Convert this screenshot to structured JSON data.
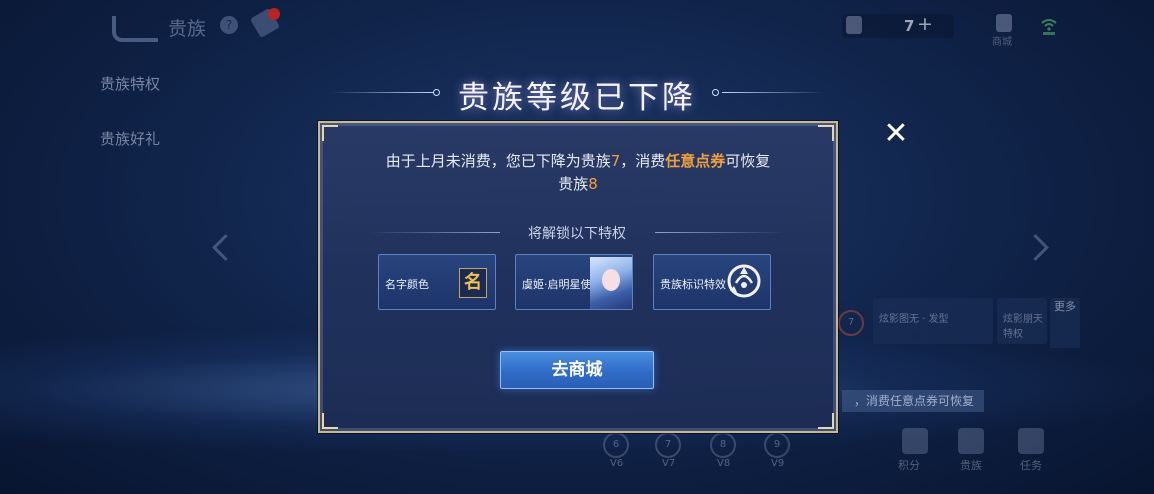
{
  "background": {
    "header": {
      "title": "贵族",
      "help_icon": "question-icon",
      "gift_badge": "新"
    },
    "side_tabs": [
      "贵族特权",
      "贵族好礼"
    ],
    "currency": {
      "value": "7",
      "plus": "+"
    },
    "shop_label": "商城",
    "cards": [
      {
        "label": "炫影图无 · 发型"
      },
      {
        "label": "炫影朋天 特权"
      }
    ],
    "more_label": "更多",
    "hint": "，消费任意点券可恢复",
    "tiers": [
      "V6",
      "V7",
      "V8",
      "V9"
    ],
    "tier_numbers": [
      "6",
      "7",
      "8",
      "9"
    ],
    "bottom_actions": [
      "积分",
      "贵族",
      "任务"
    ]
  },
  "modal": {
    "title": "贵族等级已下降",
    "message_part1": "由于上月未消费，您已下降为贵族",
    "current_level": "7",
    "message_part2": "，消费",
    "ticket_text": "任意点券",
    "message_part3": "可恢复",
    "message_part4": "贵族",
    "restore_level": "8",
    "unlock_title": "将解锁以下特权",
    "privileges": [
      {
        "label": "名字颜色",
        "icon": "name-color-icon",
        "icon_text": "名"
      },
      {
        "label": "虞姬·启明星使",
        "icon": "skin-avatar-icon"
      },
      {
        "label": "贵族标识特效",
        "icon": "noble-emblem-icon"
      }
    ],
    "go_button": "去商城",
    "close_icon": "close-icon"
  },
  "colors": {
    "accent": "#f0a03c",
    "button": "#3a7cd6",
    "frame": "#c9b88c"
  }
}
